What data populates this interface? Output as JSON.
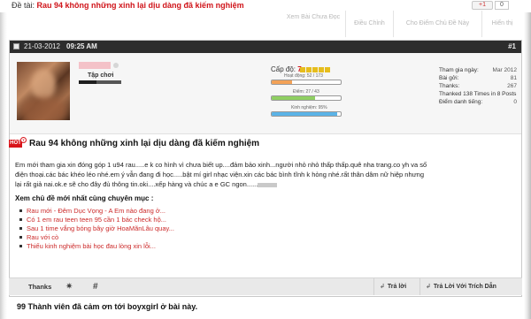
{
  "thread": {
    "label": "Đề tài:",
    "title": "Rau 94 không những xinh lại dịu dàng đã kiếm nghiệm"
  },
  "social": {
    "gplus_label": "+1",
    "count": "0"
  },
  "tools": {
    "unread": "Xem Bài Chưa Đọc",
    "rate": "Điều Chỉnh",
    "points": "Cho Điểm Chủ Đề Này",
    "display": "Hiển thị"
  },
  "post": {
    "date": "21-03-2012",
    "time": "09:25 AM",
    "number": "#1",
    "user_title": "Tập chơi",
    "level_label": "Cấp độ:",
    "level_value": "7",
    "level_note": "[|]",
    "hoat_dong": "Hoạt động: 52 / 173",
    "diem": "Điểm: 27 / 43",
    "kinh_nghiem": "Kinh nghiệm: 95%",
    "level_bars": {
      "hoat_dong": 0.3,
      "diem": 0.63,
      "kinh_nghiem": 0.95
    },
    "stats": [
      {
        "k": "Tham gia ngày:",
        "v": "Mar 2012"
      },
      {
        "k": "Bài gởi:",
        "v": "81"
      },
      {
        "k": "Thanks:",
        "v": "267"
      },
      {
        "k": "Thanked 138 Times in 8 Posts",
        "v": ""
      },
      {
        "k": "Điểm danh tiếng:",
        "v": "0"
      }
    ],
    "hot_label": "HOT",
    "heading": "Rau 94 không những xinh lại dịu dàng đã kiếm nghiệm",
    "body_lines": [
      "Em mới tham gia xin đóng góp 1 u94 rau.....e k co hình vì chưa biết up....đảm bảo xinh...người nhỏ nhỏ thấp thấp.quê nha trang.co yh va số",
      "điện thoại.các bác khéo léo nhé.em ý vẫn đang đi học.....bật mí girl nhạc viện.xin các bác bình tĩnh k hỏng nhé.rất thân dâm nữ hiệp nhưng",
      "lại rất giả nai.ok.e sẽ cho đây đủ thông tin.oki....xếp hàng và chúc a e GC ngon......"
    ],
    "related_title": "Xem chủ đề mới nhất cùng chuyên mục :",
    "related": [
      "Rau mới - Đêm Dục Vọng - A Em nào đang ở...",
      "Có 1 em rau teen teen 95 cần 1 bác check hộ...",
      "Sau 1 time vắng bóng bây giờ HoaMãnLâu quay...",
      "Rau với cò",
      "Thiếu kinh nghiệm bài học đau lòng xin lỗi..."
    ]
  },
  "footer": {
    "thanks": "Thanks",
    "reply": "Trả lời",
    "quote_reply": "Trả Lời Với Trích Dẫn"
  },
  "thanks_summary": "99 Thành viên đã cảm ơn tới boyxgirl ở bài này."
}
